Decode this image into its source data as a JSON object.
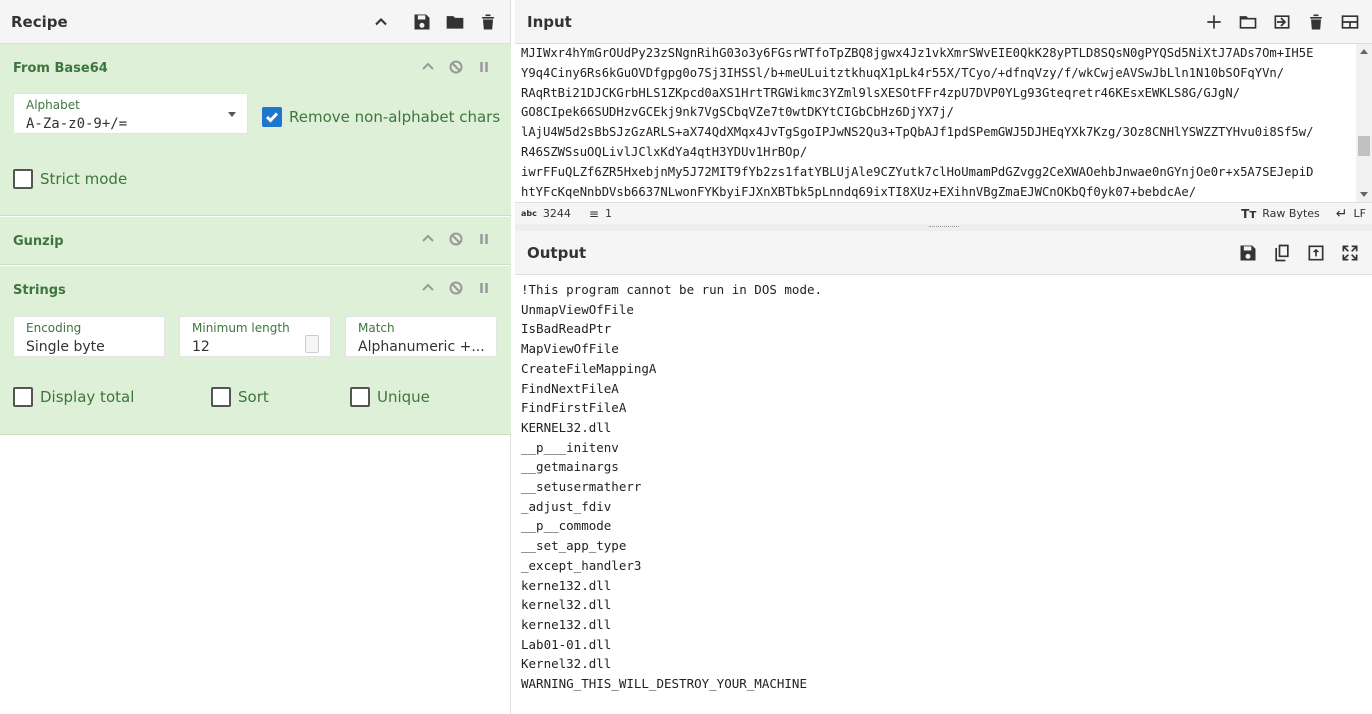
{
  "recipe": {
    "title": "Recipe",
    "icons": [
      "chevron-up-icon",
      "save-icon",
      "folder-icon",
      "trash-icon"
    ],
    "operations": [
      {
        "name": "From Base64",
        "alphabet_label": "Alphabet",
        "alphabet_value": "A-Za-z0-9+/=",
        "remove_nonalpha_label": "Remove non-alphabet chars",
        "remove_nonalpha_checked": true,
        "strict_mode_label": "Strict mode",
        "strict_mode_checked": false
      },
      {
        "name": "Gunzip"
      },
      {
        "name": "Strings",
        "encoding_label": "Encoding",
        "encoding_value": "Single byte",
        "min_length_label": "Minimum length",
        "min_length_value": "12",
        "match_label": "Match",
        "match_value": "Alphanumeric +...",
        "display_total_label": "Display total",
        "sort_label": "Sort",
        "unique_label": "Unique"
      }
    ]
  },
  "input": {
    "title": "Input",
    "lines": [
      "MJIWxr4hYmGrOUdPy23zSNgnRihG03o3y6FGsrWTfoTpZBQ8jgwx4Jz1vkXmrSWvEIE0QkK28yPTLD8SQsN0gPYQSd5NiXtJ7ADs7Om+IH5E",
      "Y9q4Ciny6Rs6kGuOVDfgpg0o7Sj3IHSSl/b+meULuitztkhuqX1pLk4r55X/TCyo/+dfnqVzy/f/wkCwjeAVSwJbLln1N10bSOFqYVn/",
      "RAqRtBi21DJCKGrbHLS1ZKpcd0aXS1HrtTRGWikmc3YZml9lsXESOtFFr4zpU7DVP0YLg93Gteqretr46KEsxEWKLS8G/GJgN/",
      "GO8CIpek66SUDHzvGCEkj9nk7VgSCbqVZe7t0wtDKYtCIGbCbHz6DjYX7j/",
      "lAjU4W5d2sBbSJzGzARLS+aX74QdXMqx4JvTgSgoIPJwNS2Qu3+TpQbAJf1pdSPemGWJ5DJHEqYXk7Kzg/3Oz8CNHlYSWZZTYHvu0i8Sf5w/",
      "R46SZWSsuOQLivlJClxKdYa4qtH3YDUv1HrBOp/",
      "iwrFFuQLZf6ZR5HxebjnMy5J72MIT9fYb2zs1fatYBLUjAle9CZYutk7clHoUmamPdGZvgg2CeXWAOehbJnwae0nGYnjOe0r+x5A7SEJepiD",
      "htYFcKqeNnbDVsb6637NLwonFYKbyiFJXnXBTbk5pLnndq69ixTI8XUz+EXihnVBgZmaEJWCnOKbQf0yk07+bebdcAe/"
    ],
    "icons": [
      "plus-icon",
      "folder-icon",
      "import-icon",
      "trash-icon",
      "layout-icon"
    ],
    "status_length": "3244",
    "status_lines": "1",
    "status_encoding": "Raw Bytes",
    "status_eol": "LF"
  },
  "output": {
    "title": "Output",
    "icons": [
      "save-icon",
      "copy-icon",
      "replace-input-icon",
      "maximize-icon"
    ],
    "text": "!This program cannot be run in DOS mode.\nUnmapViewOfFile\nIsBadReadPtr\nMapViewOfFile\nCreateFileMappingA\nFindNextFileA\nFindFirstFileA\nKERNEL32.dll\n__p___initenv\n__getmainargs\n__setusermatherr\n_adjust_fdiv\n__p__commode\n__set_app_type\n_except_handler3\nkerne132.dll\nkernel32.dll\nkerne132.dll\nLab01-01.dll\nKernel32.dll\nWARNING_THIS_WILL_DESTROY_YOUR_MACHINE"
  }
}
